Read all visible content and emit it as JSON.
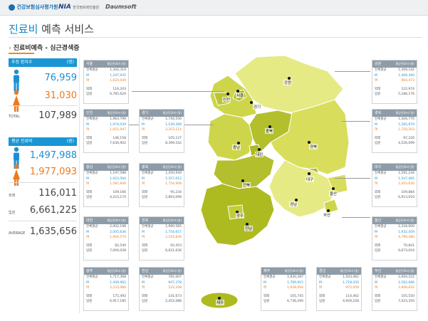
{
  "header": {
    "logo1": "건강보험심사평가원",
    "logo2": "NIA",
    "logo2_sub": "한국정보화진흥원",
    "logo3": "Daumsoft"
  },
  "page": {
    "title": "진료비",
    "title_suffix": " 예측 서비스",
    "section": "진료비예측 - 심근경색증",
    "section_arrow": "›"
  },
  "summary": {
    "patients_label": "추정 환자수",
    "patients_unit": "(명)",
    "male_patients": "76,959",
    "female_patients": "31,030",
    "total_label": "TOTAL",
    "total_patients": "107,989",
    "cost_label": "평균 진료비",
    "cost_unit": "(원)",
    "male_cost": "1,497,988",
    "female_cost": "1,977,093",
    "out_label": "외래",
    "out_cost": "116,011",
    "in_label": "입원",
    "in_cost": "6,661,225",
    "avg_label": "AVERAGE",
    "avg_cost": "1,635,656"
  },
  "labels": {
    "col": "평균진료비 (원)",
    "all": "전체평균",
    "m": "M",
    "f": "여",
    "out": "외래",
    "in": "입원"
  },
  "regions": [
    {
      "name": "서울",
      "all": "1,342,319",
      "m": "1,247,935",
      "f": "1,624,049",
      "out": "116,203",
      "in": "6,785,624"
    },
    {
      "name": "인천",
      "all": "1,963,799",
      "m": "1,974,039",
      "f": "1,921,947",
      "out": "146,158",
      "in": "7,636,902"
    },
    {
      "name": "경기",
      "all": "1,744,556",
      "m": "1,539,368",
      "f": "2,353,114",
      "out": "105,127",
      "in": "8,399,542"
    },
    {
      "name": "충남",
      "all": "1,197,588",
      "m": "1,023,584",
      "f": "1,581,846",
      "out": "109,166",
      "in": "4,223,174"
    },
    {
      "name": "충북",
      "all": "1,450,930",
      "m": "1,257,012",
      "f": "1,754,909",
      "out": "95,234",
      "in": "5,893,099"
    },
    {
      "name": "대전",
      "all": "2,002,198",
      "m": "2,005,636",
      "f": "1,994,570",
      "out": "82,540",
      "in": "7,094,028"
    },
    {
      "name": "전북",
      "all": "1,990,565",
      "m": "1,754,657",
      "f": "2,524,839",
      "out": "92,453",
      "in": "6,621,636"
    },
    {
      "name": "광주",
      "all": "1,717,368",
      "m": "1,449,962",
      "f": "2,233,080",
      "out": "175,492",
      "in": "6,917,185"
    },
    {
      "name": "전남",
      "all": "781,007",
      "m": "947,378",
      "f": "522,208",
      "out": "141,673",
      "in": "2,452,088"
    },
    {
      "name": "제주",
      "all": "1,830,287",
      "m": "1,769,915",
      "f": "1,938,094",
      "out": "105,745",
      "in": "6,736,290"
    },
    {
      "name": "경남",
      "all": "1,503,462",
      "m": "1,718,435",
      "f": "975,459",
      "out": "114,462",
      "in": "4,929,228"
    },
    {
      "name": "부산",
      "all": "2,004,222",
      "m": "1,562,086",
      "f": "3,908,832",
      "out": "105,550",
      "in": "7,023,350"
    },
    {
      "name": "울산",
      "all": "2,334,000",
      "m": "1,932,459",
      "f": "4,799,380",
      "out": "70,841",
      "in": "6,673,019"
    },
    {
      "name": "대구",
      "all": "1,591,234",
      "m": "1,547,465",
      "f": "2,203,630",
      "out": "109,884",
      "in": "6,913,010"
    },
    {
      "name": "경북",
      "all": "1,426,770",
      "m": "1,265,979",
      "f": "1,718,203",
      "out": "97,226",
      "in": "4,526,099"
    },
    {
      "name": "강원",
      "all": "1,309,142",
      "m": "1,469,360",
      "f": "964,473",
      "out": "122,974",
      "in": "5,186,176"
    }
  ],
  "map_labels": [
    "서울",
    "인천",
    "경기",
    "강원",
    "충북",
    "충남",
    "대전",
    "경북",
    "전북",
    "대구",
    "울산",
    "광주",
    "경남",
    "부산",
    "전남",
    "제주"
  ],
  "colors": {
    "accent": "#1896d3",
    "male": "#1c8fd4",
    "female": "#ed7a1c",
    "map_light": "#e6ea84",
    "map_mid": "#cdd64a",
    "map_dark": "#adbb20"
  }
}
